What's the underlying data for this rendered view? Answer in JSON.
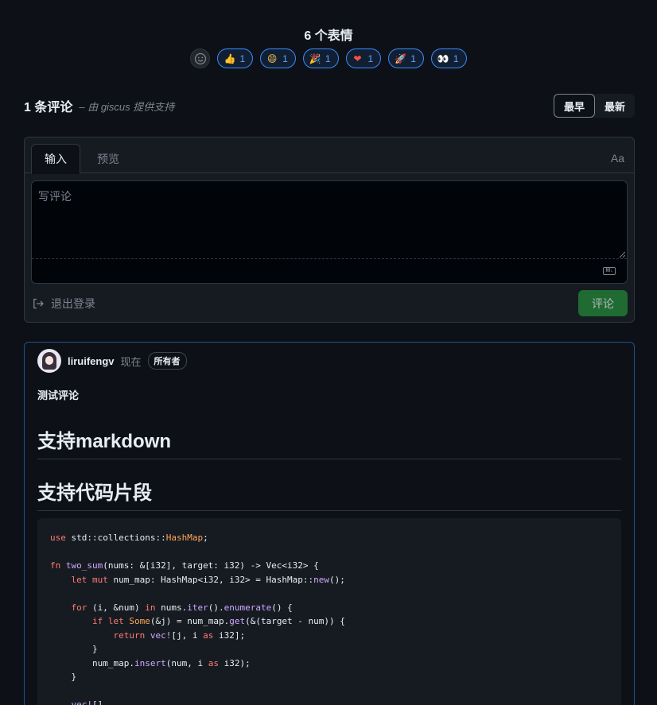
{
  "reactions": {
    "heading": "6 个表情",
    "items": [
      {
        "icon": "thumbs-up-icon",
        "glyph": "👍",
        "count": "1"
      },
      {
        "icon": "laugh-icon",
        "glyph": "😄",
        "count": "1"
      },
      {
        "icon": "hooray-icon",
        "glyph": "🎉",
        "count": "1"
      },
      {
        "icon": "heart-icon",
        "glyph": "❤",
        "count": "1"
      },
      {
        "icon": "rocket-icon",
        "glyph": "🚀",
        "count": "1"
      },
      {
        "icon": "eyes-icon",
        "glyph": "👀",
        "count": "1"
      }
    ]
  },
  "comments_header": {
    "count_label": "1 条评论",
    "powered_by": "– 由 giscus 提供支持",
    "sort_oldest": "最早",
    "sort_newest": "最新"
  },
  "editor": {
    "tab_write": "输入",
    "tab_preview": "预览",
    "text_size_toggle": "Aa",
    "placeholder": "写评论",
    "sign_out": "退出登录",
    "submit": "评论",
    "markdown_badge": "M↓"
  },
  "comment": {
    "author": "liruifengv",
    "time": "现在",
    "badge": "所有者",
    "paragraph": "测试评论",
    "heading1": "支持markdown",
    "heading2": "支持代码片段",
    "code_lines": [
      "use std::collections::HashMap;",
      "",
      "fn two_sum(nums: &[i32], target: i32) -> Vec<i32> {",
      "    let mut num_map: HashMap<i32, i32> = HashMap::new();",
      "",
      "    for (i, &num) in nums.iter().enumerate() {",
      "        if let Some(&j) = num_map.get(&(target - num)) {",
      "            return vec![j, i as i32];",
      "        }",
      "        num_map.insert(num, i as i32);",
      "    }",
      "",
      "    vec![]"
    ]
  }
}
